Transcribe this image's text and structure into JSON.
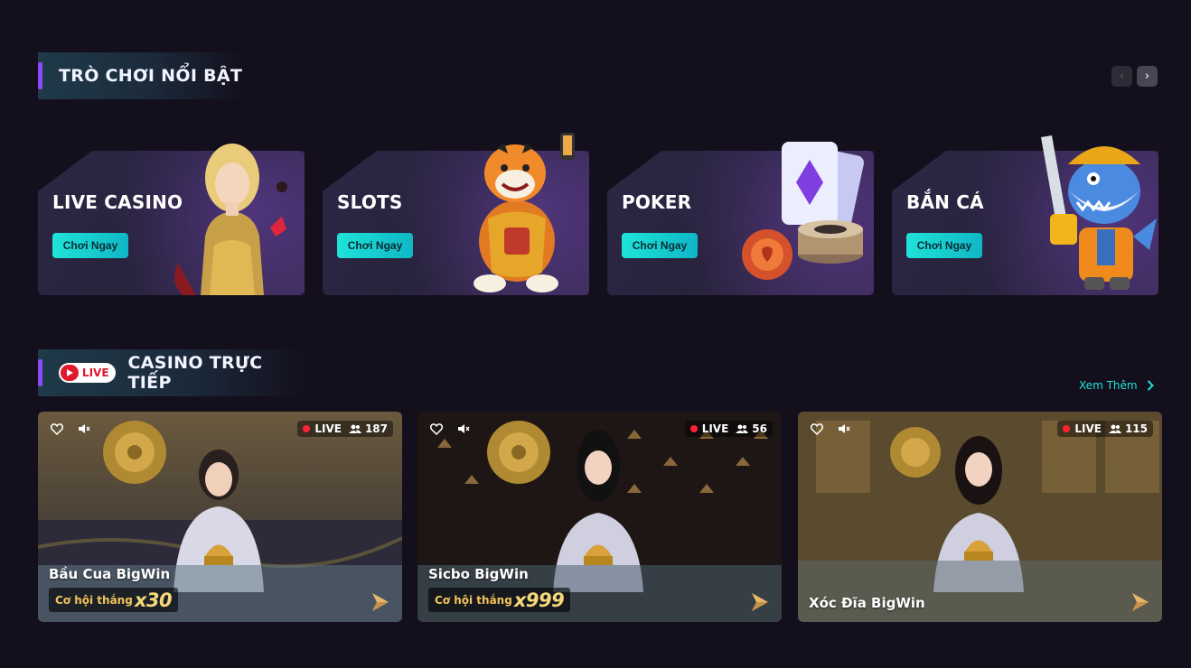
{
  "featured": {
    "title": "TRÒ CHƠI NỔI BẬT",
    "nav": {
      "prev_icon": "chevron-left-icon",
      "next_icon": "chevron-right-icon"
    },
    "cards": [
      {
        "title": "LIVE CASINO",
        "button": "Chơi Ngay",
        "art": "live-dealer-art"
      },
      {
        "title": "SLOTS",
        "button": "Chơi Ngay",
        "art": "tiger-mascot-art"
      },
      {
        "title": "POKER",
        "button": "Chơi Ngay",
        "art": "cards-chips-art"
      },
      {
        "title": "BẮN CÁ",
        "button": "Chơi Ngay",
        "art": "shark-mascot-art"
      }
    ]
  },
  "live": {
    "badge": "LIVE",
    "title": "CASINO TRỰC TIẾP",
    "see_more": "Xem Thêm",
    "tables": [
      {
        "name": "Bầu Cua BigWin",
        "status": "LIVE",
        "viewers": "187",
        "win_label": "Cơ hội thắng",
        "win_multiplier": "x30"
      },
      {
        "name": "Sicbo BigWin",
        "status": "LIVE",
        "viewers": "56",
        "win_label": "Cơ hội thắng",
        "win_multiplier": "x999"
      },
      {
        "name": "Xóc Đĩa BigWin",
        "status": "LIVE",
        "viewers": "115"
      }
    ]
  },
  "colors": {
    "background": "#140f1d",
    "accent_teal": "#1fe3d8",
    "accent_purple": "#8a4cf6",
    "live_red": "#e1172d",
    "gold": "#f6d77a"
  }
}
